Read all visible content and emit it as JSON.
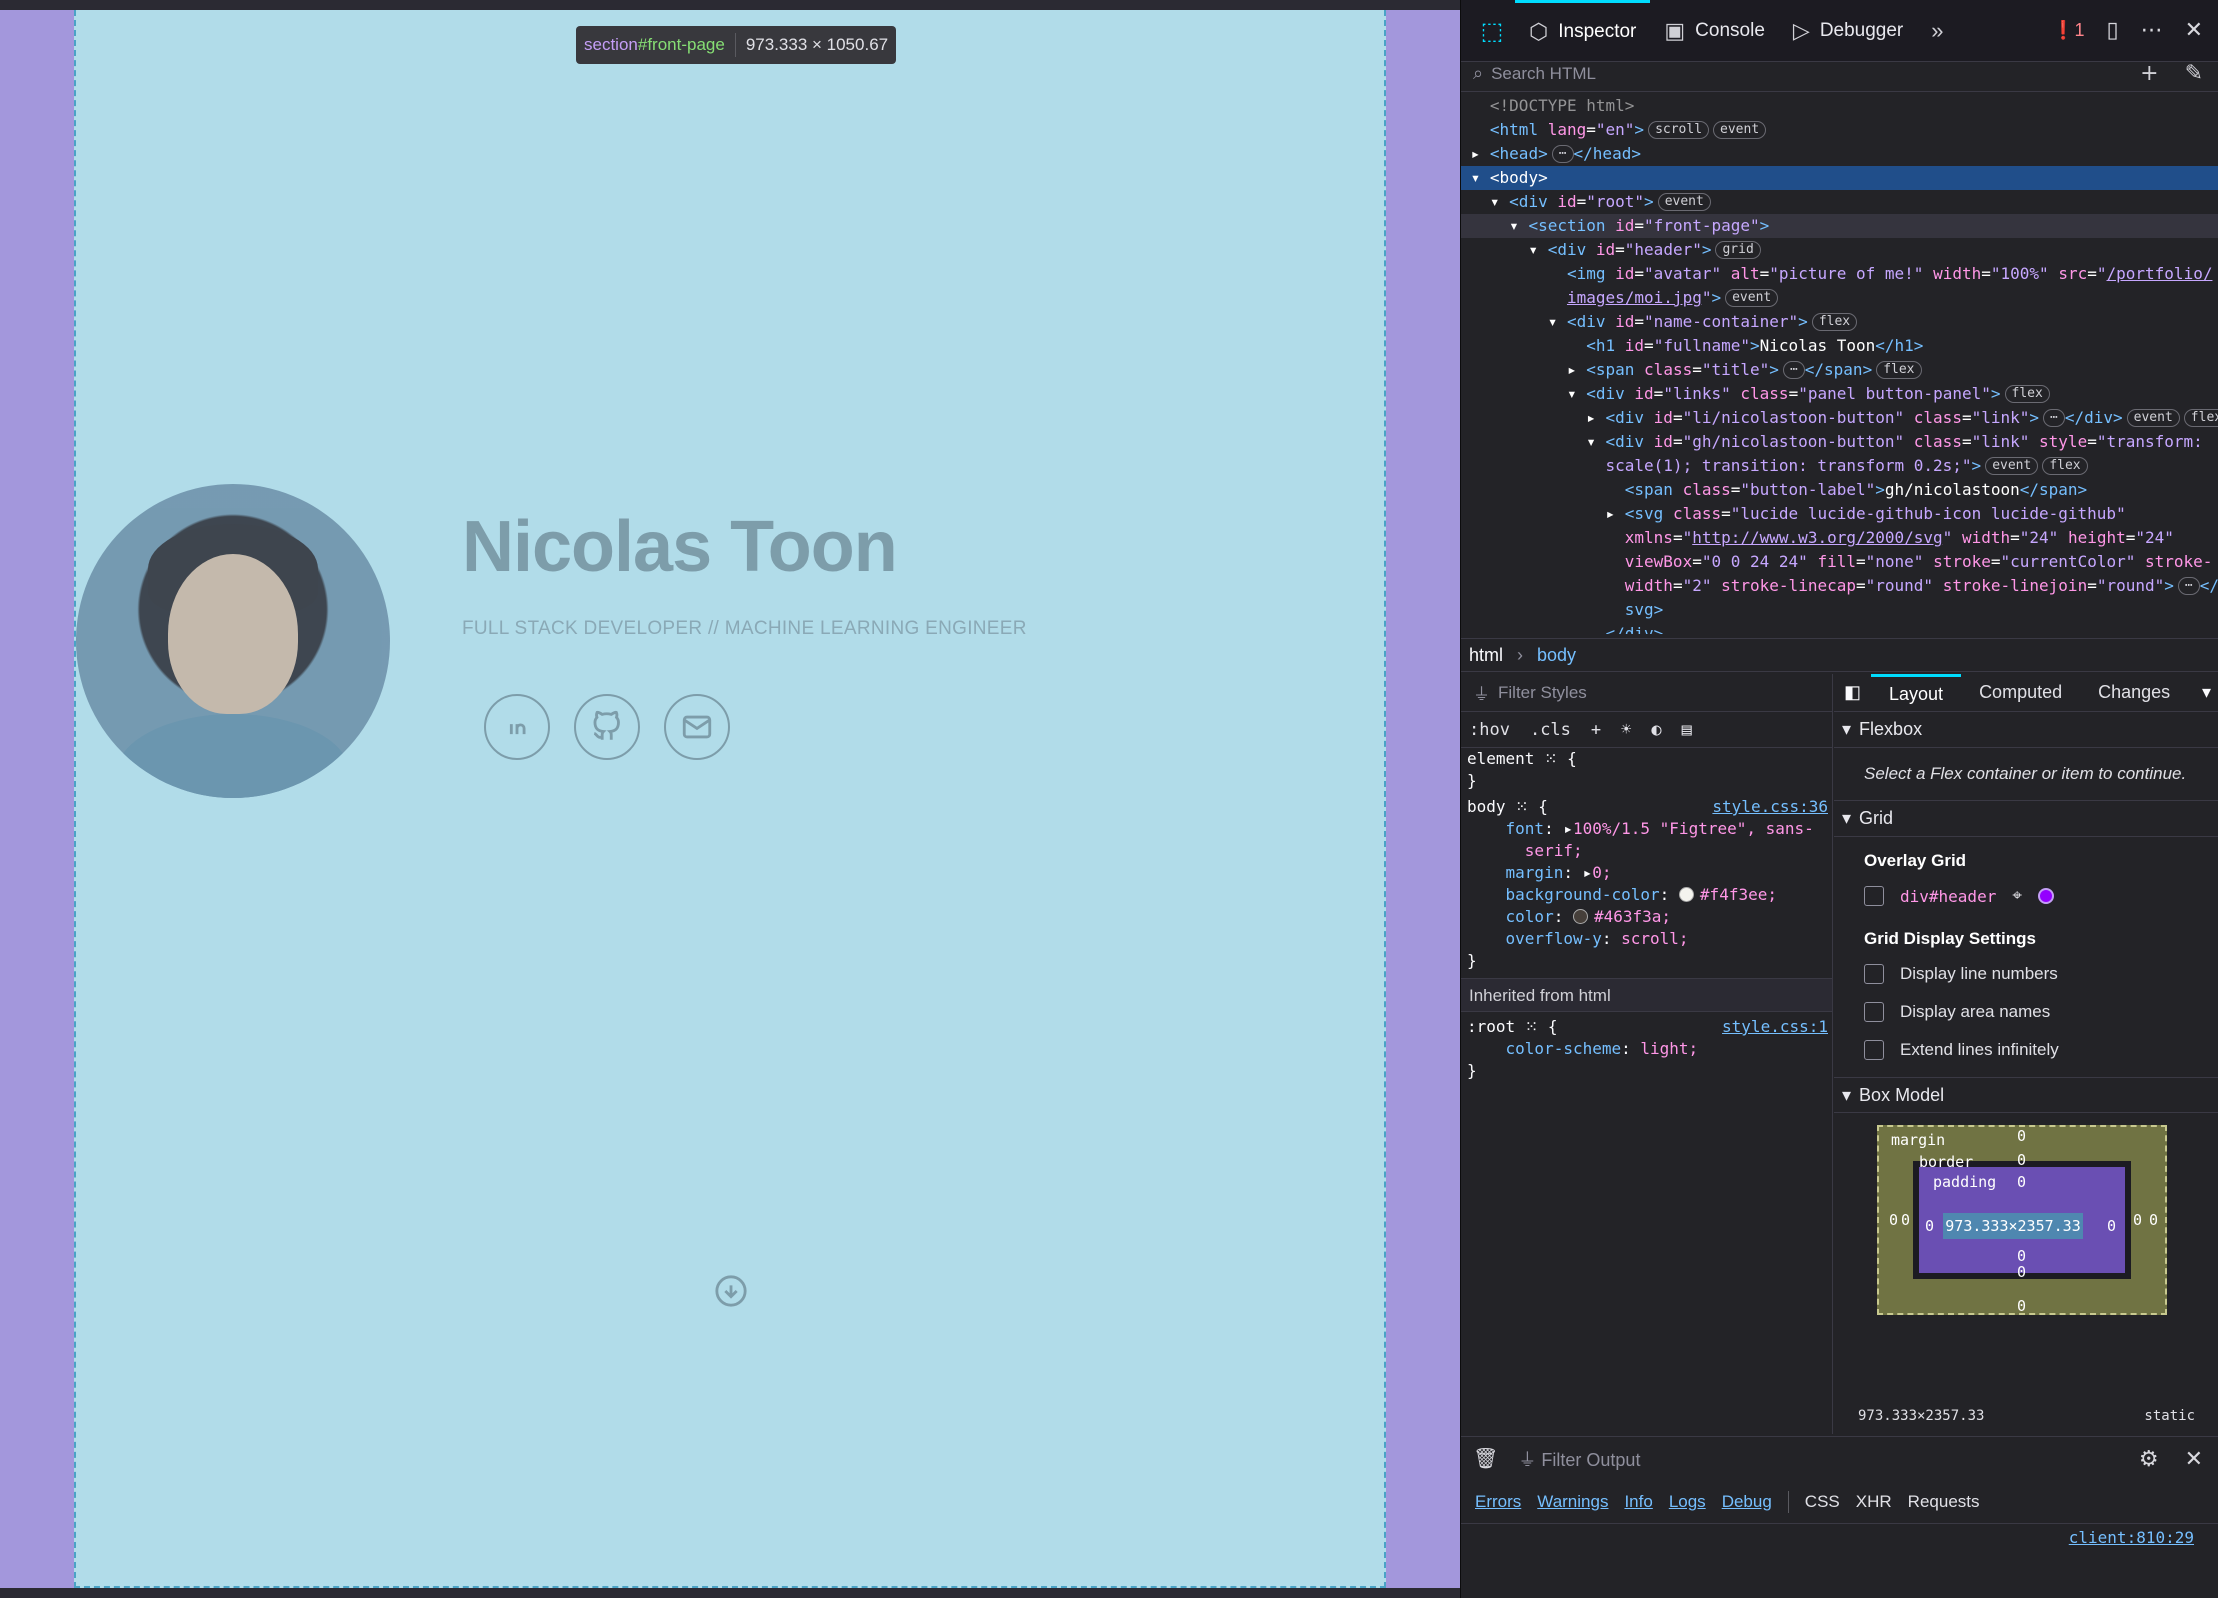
{
  "page": {
    "fullname": "Nicolas Toon",
    "subtitle": "FULL STACK DEVELOPER // MACHINE LEARNING ENGINEER",
    "social": [
      "linkedin-icon",
      "github-icon",
      "mail-icon"
    ],
    "colors": {
      "section_bg": "#b1dce9",
      "margin_overlay": "#a397dc",
      "name_color": "#7d9daa"
    }
  },
  "tooltip": {
    "tag": "section",
    "id": "#front-page",
    "dims": "973.333 × 1050.67"
  },
  "devtools": {
    "tabs": [
      "Inspector",
      "Console",
      "Debugger"
    ],
    "error_count": "1",
    "search_placeholder": "Search HTML",
    "breadcrumb": [
      "html",
      "body"
    ],
    "styles_filter": "Filter Styles",
    "rule_tools": [
      ":hov",
      ".cls"
    ],
    "rules": {
      "element_sel": "element",
      "body_sel": "body",
      "body_src": "style.css:36",
      "font": "100%/1.5 \"Figtree\", sans-",
      "font_cont": "serif;",
      "margin": "0;",
      "bg": "#f4f3ee;",
      "color": "#463f3a;",
      "overflow": "scroll;",
      "inherited": "Inherited from html",
      "root_sel": ":root",
      "root_src": "style.css:1",
      "scheme": "light;"
    },
    "layout_tabs": [
      "Layout",
      "Computed",
      "Changes"
    ],
    "flexbox_title": "Flexbox",
    "flexbox_note": "Select a Flex container or item to continue.",
    "grid_title": "Grid",
    "overlay_grid": "Overlay Grid",
    "grid_item": "div#header",
    "grid_display": "Grid Display Settings",
    "grid_opts": [
      "Display line numbers",
      "Display area names",
      "Extend lines infinitely"
    ],
    "boxmodel_title": "Box Model",
    "bm": {
      "margin": "margin",
      "border": "border",
      "padding": "padding",
      "content": "973.333×2357.33",
      "zero": "0",
      "footer": "973.333×2357.33",
      "position": "static"
    },
    "console_filter": "Filter Output",
    "console_tabs": [
      "Errors",
      "Warnings",
      "Info",
      "Logs",
      "Debug",
      "CSS",
      "XHR",
      "Requests"
    ],
    "console_loc": "client:810:29"
  }
}
